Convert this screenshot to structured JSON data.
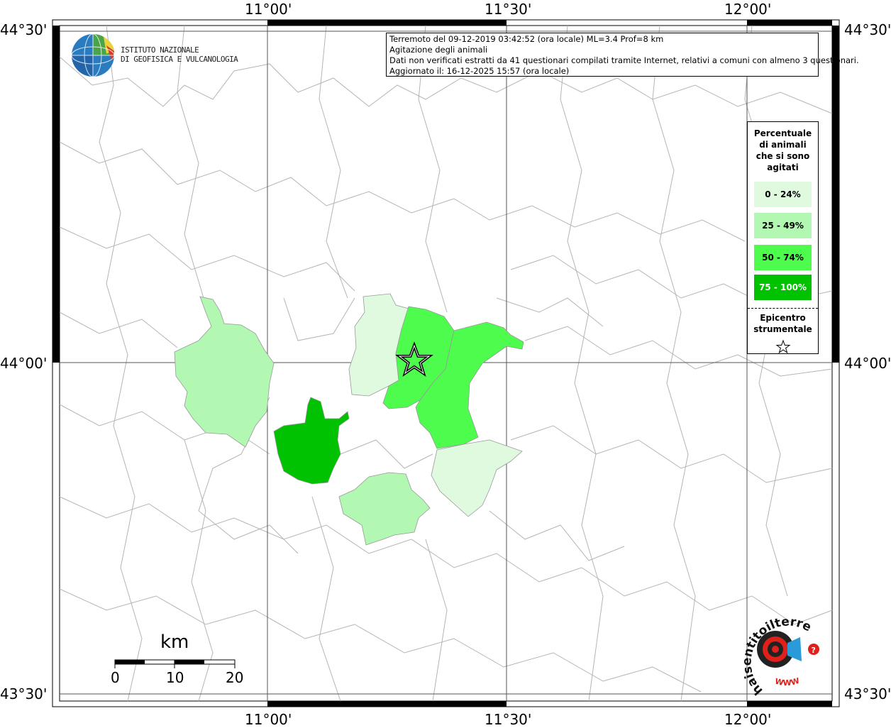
{
  "map": {
    "title_line1": "Terremoto del 09-12-2019 03:42:52 (ora locale) ML=3.4 Prof=8 km",
    "title_line2": "Agitazione degli animali",
    "title_line3": "Dati non verificati estratti da 41 questionari compilati tramite Internet, relativi a comuni con almeno 3 questionari.",
    "title_line4": "Aggiornato il: 16-12-2025 15:57 (ora locale)"
  },
  "axes": {
    "top": [
      "11°00'",
      "11°30'",
      "12°00'"
    ],
    "bottom": [
      "11°00'",
      "11°30'",
      "12°00'"
    ],
    "left": [
      "44°30'",
      "44°00'",
      "43°30'"
    ],
    "right": [
      "44°30'",
      "44°00'",
      "43°30'"
    ]
  },
  "legend": {
    "title_lines": [
      "Percentuale",
      "di animali",
      "che si sono",
      "agitati"
    ],
    "classes": [
      {
        "label": "0 - 24%",
        "color": "#dffadf"
      },
      {
        "label": "25 - 49%",
        "color": "#b2f8b2"
      },
      {
        "label": "50 - 74%",
        "color": "#4dfc4d"
      },
      {
        "label": "75 - 100%",
        "color": "#00c200"
      }
    ],
    "epicenter_lines": [
      "Epicentro",
      "strumentale"
    ]
  },
  "logo": {
    "ingv_line1": "ISTITUTO NAZIONALE",
    "ingv_line2": "DI GEOFISICA E VULCANOLOGIA",
    "hst_text": "haisentitoilterremoto.it",
    "hst_www": "WWW"
  },
  "scale": {
    "unit": "km",
    "ticks": [
      "0",
      "10",
      "20"
    ]
  }
}
